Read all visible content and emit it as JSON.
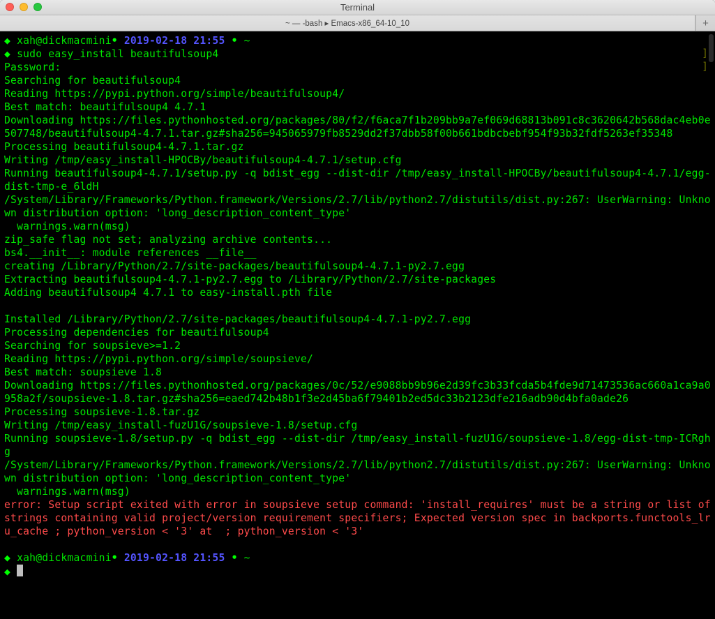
{
  "window": {
    "title": "Terminal"
  },
  "tabs": [
    {
      "label": "~ — -bash ▸ Emacs-x86_64-10_10",
      "active": true
    }
  ],
  "prompt": {
    "userhost": "xah@dickmacmini",
    "timestamp": "2019-02-18 21:55",
    "path": "~",
    "bullet": "◆",
    "dot": "•"
  },
  "command": "sudo easy_install beautifulsoup4",
  "output_lines": [
    "Password:",
    "Searching for beautifulsoup4",
    "Reading https://pypi.python.org/simple/beautifulsoup4/",
    "Best match: beautifulsoup4 4.7.1",
    "Downloading https://files.pythonhosted.org/packages/80/f2/f6aca7f1b209bb9a7ef069d68813b091c8c3620642b568dac4eb0e507748/beautifulsoup4-4.7.1.tar.gz#sha256=945065979fb8529dd2f37dbb58f00b661bdbcbebf954f93b32fdf5263ef35348",
    "Processing beautifulsoup4-4.7.1.tar.gz",
    "Writing /tmp/easy_install-HPOCBy/beautifulsoup4-4.7.1/setup.cfg",
    "Running beautifulsoup4-4.7.1/setup.py -q bdist_egg --dist-dir /tmp/easy_install-HPOCBy/beautifulsoup4-4.7.1/egg-dist-tmp-e_6ldH",
    "/System/Library/Frameworks/Python.framework/Versions/2.7/lib/python2.7/distutils/dist.py:267: UserWarning: Unknown distribution option: 'long_description_content_type'",
    "  warnings.warn(msg)",
    "zip_safe flag not set; analyzing archive contents...",
    "bs4.__init__: module references __file__",
    "creating /Library/Python/2.7/site-packages/beautifulsoup4-4.7.1-py2.7.egg",
    "Extracting beautifulsoup4-4.7.1-py2.7.egg to /Library/Python/2.7/site-packages",
    "Adding beautifulsoup4 4.7.1 to easy-install.pth file",
    "",
    "Installed /Library/Python/2.7/site-packages/beautifulsoup4-4.7.1-py2.7.egg",
    "Processing dependencies for beautifulsoup4",
    "Searching for soupsieve>=1.2",
    "Reading https://pypi.python.org/simple/soupsieve/",
    "Best match: soupsieve 1.8",
    "Downloading https://files.pythonhosted.org/packages/0c/52/e9088bb9b96e2d39fc3b33fcda5b4fde9d71473536ac660a1ca9a0958a2f/soupsieve-1.8.tar.gz#sha256=eaed742b48b1f3e2d45ba6f79401b2ed5dc33b2123dfe216adb90d4bfa0ade26",
    "Processing soupsieve-1.8.tar.gz",
    "Writing /tmp/easy_install-fuzU1G/soupsieve-1.8/setup.cfg",
    "Running soupsieve-1.8/setup.py -q bdist_egg --dist-dir /tmp/easy_install-fuzU1G/soupsieve-1.8/egg-dist-tmp-ICRghg",
    "/System/Library/Frameworks/Python.framework/Versions/2.7/lib/python2.7/distutils/dist.py:267: UserWarning: Unknown distribution option: 'long_description_content_type'",
    "  warnings.warn(msg)"
  ],
  "error_line": "error: Setup script exited with error in soupsieve setup command: 'install_requires' must be a string or list of strings containing valid project/version requirement specifiers; Expected version spec in backports.functools_lru_cache ; python_version < '3' at  ; python_version < '3'",
  "colors": {
    "bg": "#000000",
    "fg": "#00e400",
    "accent_blue": "#5454ff",
    "error_red": "#ff4b4b"
  }
}
